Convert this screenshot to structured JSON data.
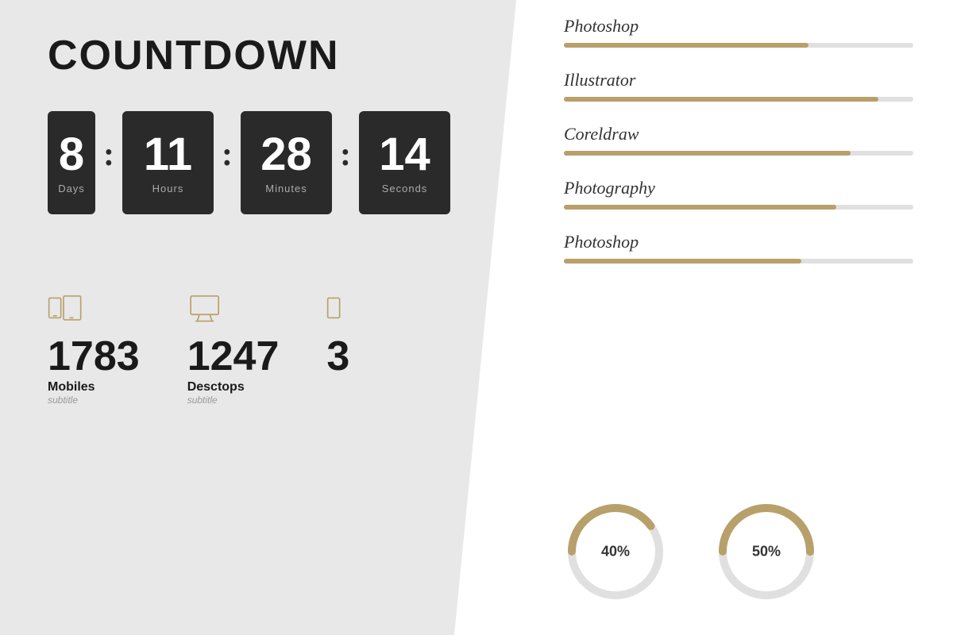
{
  "left": {
    "title": "COUNTDOWN",
    "units": [
      {
        "value": "8",
        "label": "Days",
        "partial": true
      },
      {
        "value": "11",
        "label": "Hours",
        "partial": false
      },
      {
        "value": "28",
        "label": "Minutes",
        "partial": false
      },
      {
        "value": "14",
        "label": "Seconds",
        "partial": false
      }
    ],
    "separators": [
      ":",
      ":",
      ":"
    ],
    "stats": [
      {
        "icon": "mobile-icon",
        "number": "1783",
        "title": "Mobiles",
        "subtitle": "subtitle",
        "partial": false
      },
      {
        "icon": "desktop-icon",
        "number": "1247",
        "title": "Desctops",
        "subtitle": "subtitle",
        "partial": false
      },
      {
        "icon": "tablet-icon",
        "number": "3",
        "title": "",
        "subtitle": "",
        "partial": true
      }
    ]
  },
  "right": {
    "skills": [
      {
        "name": "Photoshop",
        "percent": 70
      },
      {
        "name": "Illustrator",
        "percent": 90
      },
      {
        "name": "Coreldraw",
        "percent": 82
      },
      {
        "name": "Photography",
        "percent": 78
      },
      {
        "name": "Photoshop",
        "percent": 68
      }
    ],
    "donuts": [
      {
        "percent": 40,
        "label": "40%"
      },
      {
        "percent": 50,
        "label": "50%"
      }
    ]
  },
  "colors": {
    "accent": "#b8a06a",
    "dark": "#2a2a2a",
    "light_gray": "#e0e0e0",
    "white": "#ffffff"
  }
}
